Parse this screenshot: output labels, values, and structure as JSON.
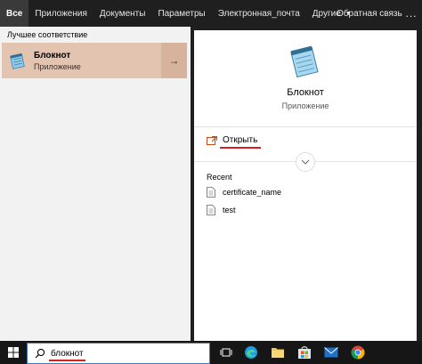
{
  "tabs": [
    {
      "label": "Все",
      "active": true
    },
    {
      "label": "Приложения"
    },
    {
      "label": "Документы"
    },
    {
      "label": "Параметры"
    },
    {
      "label": "Электронная_почта"
    },
    {
      "label": "Другие"
    }
  ],
  "feedback_label": "Обратная связь",
  "more_label": "...",
  "left": {
    "section_title": "Лучшее соответствие",
    "best_match": {
      "name": "Блокнот",
      "type": "Приложение"
    }
  },
  "right": {
    "app_name": "Блокнот",
    "app_type": "Приложение",
    "open_label": "Открыть",
    "recent_title": "Recent",
    "recent_items": [
      "certificate_name",
      "test"
    ]
  },
  "search": {
    "value": "блокнот"
  },
  "colors": {
    "best_match_bg": "#e3c4b1",
    "annotation_red": "#d81e1e",
    "taskbar_bg": "#161616",
    "tabbar_bg": "#1f1f1f"
  },
  "taskbar_icons": [
    "task-view-icon",
    "edge-icon",
    "file-explorer-icon",
    "store-icon",
    "mail-icon",
    "chrome-icon"
  ]
}
